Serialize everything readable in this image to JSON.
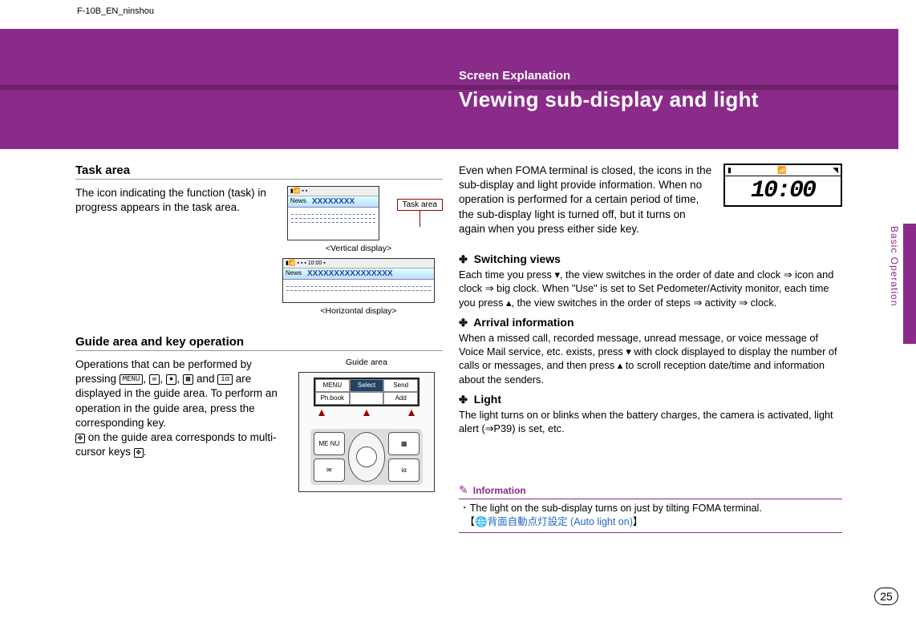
{
  "doc_id": "F-10B_EN_ninshou",
  "side_tab": "Basic Operation",
  "page_number": "25",
  "left": {
    "section1_title": "Task area",
    "section1_body": "The icon indicating the function (task) in progress appears in the task area.",
    "fig_callout": "Task area",
    "fig_news_label": "News",
    "fig_xtext_short": "XXXXXXXX",
    "fig_xtext_long": "XXXXXXXXXXXXXXXX",
    "caption_vertical": "<Vertical display>",
    "caption_horizontal": "<Horizontal display>",
    "section2_title": "Guide area and key operation",
    "section2_body_1": "Operations that can be performed by pressing ",
    "section2_body_keys": [
      "MENU",
      "✉",
      "●",
      "▦",
      "iα"
    ],
    "section2_body_2": " are displayed in the guide area. To perform an operation in the guide area, press the corresponding key.",
    "section2_body_3": " on the guide area corresponds to multi-cursor keys ",
    "guide_caption": "Guide area",
    "guide_lcd": {
      "row1": [
        "MENU",
        "Select",
        "Send"
      ],
      "row2": [
        "Ph.book",
        "",
        "Add"
      ]
    },
    "keypad": [
      "ME\nNU",
      "▦",
      "✉",
      "iα"
    ]
  },
  "right": {
    "band_subtitle": "Screen Explanation",
    "band_title": "Viewing sub-display and light",
    "intro": "Even when FOMA terminal is closed, the icons in the sub-display and light provide information. When no operation is performed for a certain period of time, the sub-display light is turned off, but it turns on again when you press either side key.",
    "sd_time": "10:00",
    "sub1_title": "Switching views",
    "sub1_body": "Each time you press ▾, the view switches in the order of date and clock ⇒ icon and clock ⇒ big clock. When \"Use\" is set to Set Pedometer/Activity monitor, each time you press ▴, the view switches in the order of steps ⇒ activity ⇒ clock.",
    "sub2_title": "Arrival information",
    "sub2_body": "When a missed call, recorded message, unread message, or voice message of Voice Mail service, etc. exists, press ▾ with clock displayed to display the number of calls or messages, and then press ▴ to scroll reception date/time and information about the senders.",
    "sub3_title": "Light",
    "sub3_body": "The light turns on or blinks when the battery charges, the camera is activated, light alert (⇒P39) is set, etc.",
    "info_label": "Information",
    "info_bullet": "The light on the sub-display turns on just by tilting FOMA terminal.",
    "info_jp_text": "背面自動点灯設定 (Auto light on)"
  }
}
